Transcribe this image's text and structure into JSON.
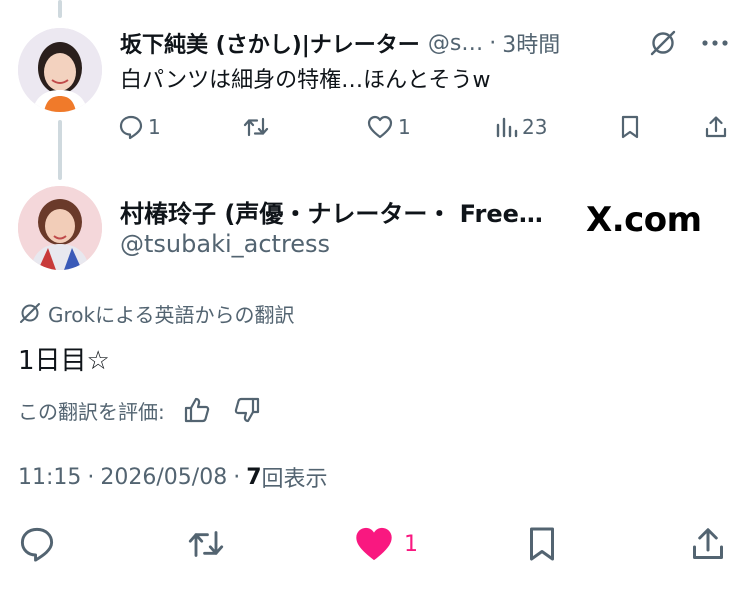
{
  "reply": {
    "display_name": "坂下純美 (さかし)|ナレーター",
    "handle": "@s…",
    "separator": "·",
    "time": "3時間",
    "text": "白パンツは細身の特権…ほんとそうw",
    "actions": {
      "replies": "1",
      "reposts": "",
      "likes": "1",
      "views": "23"
    }
  },
  "post": {
    "display_name": "村椿玲子 (声優・ナレーター・ Free…",
    "handle": "@tsubaki_actress",
    "watermark": "X.com",
    "translation_note": "Grokによる英語からの翻訳",
    "text": "1日目☆",
    "rate_label": "この翻訳を評価:",
    "time": "11:15",
    "separator": "·",
    "date": "2026/05/08",
    "views_count": "7",
    "views_label": "回表示",
    "like_count": "1"
  },
  "colors": {
    "text_primary": "#0f1419",
    "text_secondary": "#536471",
    "like_pink": "#f91880",
    "thread_line": "#cfd9de"
  },
  "icons": {
    "grok": "grok-slash-icon",
    "more": "more-dots-icon",
    "reply": "reply-bubble-icon",
    "repost": "repost-arrows-icon",
    "like": "heart-icon",
    "views": "views-bars-icon",
    "bookmark": "bookmark-icon",
    "share": "share-upload-icon",
    "thumbs_up": "thumbs-up-icon",
    "thumbs_down": "thumbs-down-icon"
  }
}
